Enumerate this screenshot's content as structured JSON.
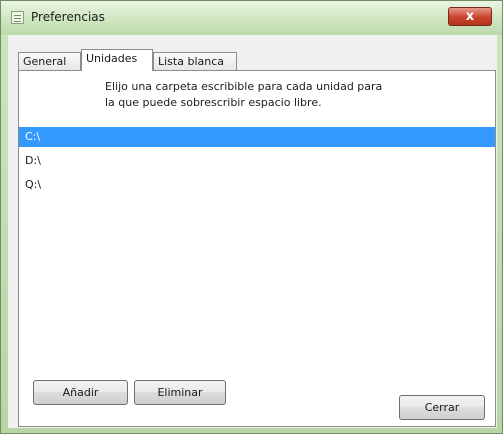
{
  "window": {
    "title": "Preferencias",
    "close_glyph": "x"
  },
  "tabs": [
    {
      "label": "General"
    },
    {
      "label": "Unidades"
    },
    {
      "label": "Lista blanca"
    }
  ],
  "panel": {
    "description_line1": "Elijo una carpeta escribible para cada unidad para",
    "description_line2": "la que puede sobrescribir espacio libre.",
    "drives": [
      {
        "label": "C:\\",
        "selected": true
      },
      {
        "label": "D:\\",
        "selected": false
      },
      {
        "label": "Q:\\",
        "selected": false
      }
    ],
    "add_label": "Añadir",
    "remove_label": "Eliminar"
  },
  "footer": {
    "close_label": "Cerrar"
  },
  "colors": {
    "selection": "#3399ff",
    "titlebar": "#cfe6c1",
    "close_button": "#c7432c"
  },
  "icons": {
    "app": "app-window-icon",
    "close": "close-icon"
  }
}
